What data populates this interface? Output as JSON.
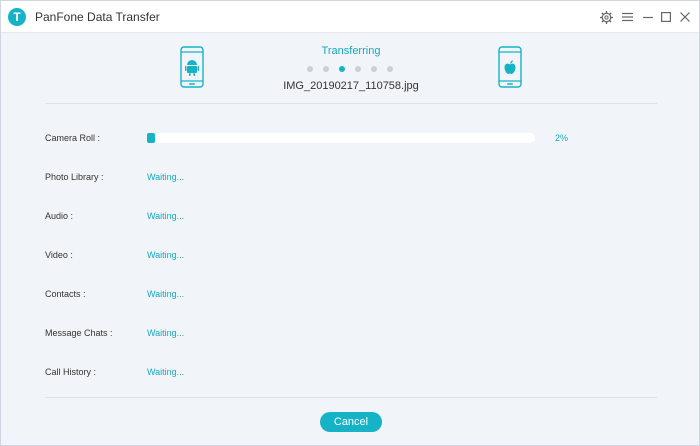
{
  "app": {
    "title": "PanFone Data Transfer",
    "logo_letter": "T",
    "accent_color": "#16b3c7"
  },
  "titlebar_icons": [
    "gear-icon",
    "menu-icon",
    "minimize-icon",
    "maximize-icon",
    "close-icon"
  ],
  "transfer": {
    "status_label": "Transferring",
    "current_file": "IMG_20190217_110758.jpg",
    "source_device_icon": "android-phone-icon",
    "target_device_icon": "apple-phone-icon",
    "step_dots": 6,
    "active_dot": 3
  },
  "categories": [
    {
      "label": "Camera Roll :",
      "status": "",
      "progress_percent": 2,
      "progress_text": "2%"
    },
    {
      "label": "Photo Library :",
      "status": "Waiting..."
    },
    {
      "label": "Audio :",
      "status": "Waiting..."
    },
    {
      "label": "Video :",
      "status": "Waiting..."
    },
    {
      "label": "Contacts :",
      "status": "Waiting..."
    },
    {
      "label": "Message Chats :",
      "status": "Waiting..."
    },
    {
      "label": "Call History :",
      "status": "Waiting..."
    }
  ],
  "actions": {
    "cancel_label": "Cancel"
  }
}
